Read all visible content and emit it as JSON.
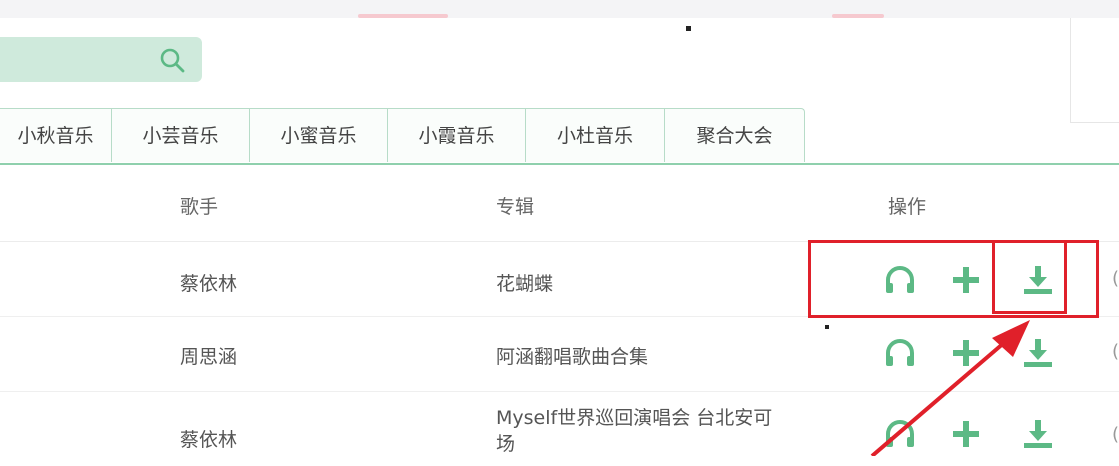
{
  "search": {
    "value": "",
    "placeholder": ""
  },
  "tabs": [
    {
      "label": "小秋音乐"
    },
    {
      "label": "小芸音乐"
    },
    {
      "label": "小蜜音乐"
    },
    {
      "label": "小霞音乐"
    },
    {
      "label": "小杜音乐"
    },
    {
      "label": "聚合大会"
    }
  ],
  "table": {
    "headers": {
      "singer": "歌手",
      "album": "专辑",
      "ops": "操作"
    },
    "rows": [
      {
        "singer": "蔡依林",
        "album": "花蝴蝶",
        "album2": "",
        "edge": "("
      },
      {
        "singer": "周思涵",
        "album": "阿涵翻唱歌曲合集",
        "album2": "",
        "edge": "("
      },
      {
        "singer": "蔡依林",
        "album": "Myself世界巡回演唱会 台北安可",
        "album2": "场",
        "edge": "("
      }
    ]
  },
  "icons": {
    "listen": "headphones-icon",
    "add": "plus-icon",
    "download": "download-icon",
    "search": "search-icon"
  },
  "colors": {
    "accent": "#5cb985",
    "highlight": "#e0202a",
    "search_bg": "#cfeadc",
    "tab_border": "#b7dcc8"
  }
}
